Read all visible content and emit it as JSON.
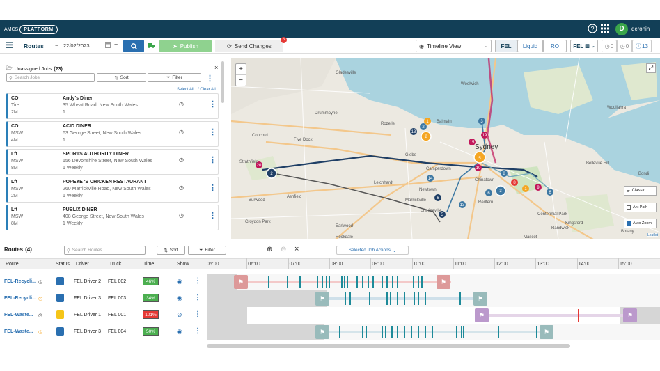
{
  "app": {
    "logo_prefix": "AMCS",
    "logo_text": "PLATFORM",
    "user_initial": "D",
    "user_name": "dcronin"
  },
  "toolbar": {
    "menu_icon": "hamburger-icon",
    "title": "Routes",
    "date_minus": "−",
    "date": "22/02/2023",
    "date_plus": "+",
    "search_icon": "search-icon",
    "publish": "Publish",
    "send_changes": "Send Changes",
    "send_badge": "3",
    "view_select": "Timeline View",
    "tabs": [
      "FEL",
      "Liquid",
      "RO"
    ],
    "fel_select": "FEL",
    "counts": [
      "0",
      "0",
      "13"
    ]
  },
  "unassigned": {
    "title": "Unassigned Jobs",
    "count": "(23)",
    "search_placeholder": "Search Jobs",
    "sort": "Sort",
    "filter": "Filter",
    "select_all": "Select All",
    "clear_all": "/ Clear All",
    "jobs": [
      {
        "code": "CO",
        "type": "Tire",
        "size": "2M",
        "name": "Andy's Diner",
        "address": "35 Wheat Road, New South Wales",
        "freq": "1"
      },
      {
        "code": "CO",
        "type": "MSW",
        "size": "4M",
        "name": "ACID DINER",
        "address": "63 George Street, New South Wales",
        "freq": "1"
      },
      {
        "code": "Lft",
        "type": "MSW",
        "size": "8M",
        "name": "SPORTS AUTHORITY DINER",
        "address": "156 Devonshire Street, New South Wales",
        "freq": "1 Weekly"
      },
      {
        "code": "Lft",
        "type": "MSW",
        "size": "2M",
        "name": "POPEYE 'S CHICKEN RESTAURANT",
        "address": "260 Marrickville Road, New South Wales",
        "freq": "1 Weekly"
      },
      {
        "code": "Lft",
        "type": "MSW",
        "size": "8M",
        "name": "PUBLIX DINER",
        "address": "408 George Street, New South Wales",
        "freq": "1 Weekly"
      }
    ]
  },
  "map": {
    "zoom_in": "+",
    "zoom_out": "−",
    "legend": {
      "classic": "Classic",
      "ant_path": "Ant Path",
      "auto_zoom": "Auto Zoom"
    },
    "attribution": "Leaflet",
    "labels": [
      "Gladesville",
      "Woolwich",
      "Woollahra",
      "Balmain",
      "Rozelle",
      "Sydney",
      "Chinatown",
      "Redfern",
      "Bellevue Hill",
      "Bondi",
      "Burwood",
      "Ashfield",
      "Marrickville",
      "Leichhardt",
      "Camperdown",
      "Glebe",
      "Centennial Park",
      "Randwick",
      "Croydon Park",
      "Earlwood",
      "Mascot",
      "Rockdale",
      "Kingsford",
      "Botany",
      "Drummoyne",
      "Five Dock",
      "Concord",
      "Strathfield",
      "Newtown",
      "Erskineville"
    ]
  },
  "routes": {
    "title": "Routes",
    "count": "(4)",
    "search_placeholder": "Search Routes",
    "sort": "Sort",
    "filter": "Filter",
    "selected_actions": "Selected Job Actions",
    "headers": [
      "Route",
      "Status",
      "Driver",
      "Truck",
      "Time",
      "Show"
    ],
    "hours": [
      "05:00",
      "06:00",
      "07:00",
      "08:00",
      "09:00",
      "10:00",
      "11:00",
      "12:00",
      "13:00",
      "14:00",
      "15:00"
    ],
    "rows": [
      {
        "route": "FEL-Recycli...",
        "driver": "FEL Driver 2",
        "truck": "FEL 002",
        "time": "46%",
        "time_color": "#4caf50"
      },
      {
        "route": "FEL-Recycli...",
        "driver": "FEL Driver 3",
        "truck": "FEL 003",
        "time": "34%",
        "time_color": "#4caf50"
      },
      {
        "route": "FEL-Waste...",
        "driver": "FEL Driver 1",
        "truck": "FEL 001",
        "time": "101%",
        "time_color": "#e53935"
      },
      {
        "route": "FEL-Waste...",
        "driver": "FEL Driver 3",
        "truck": "FEL 004",
        "time": "50%",
        "time_color": "#4caf50"
      }
    ]
  }
}
